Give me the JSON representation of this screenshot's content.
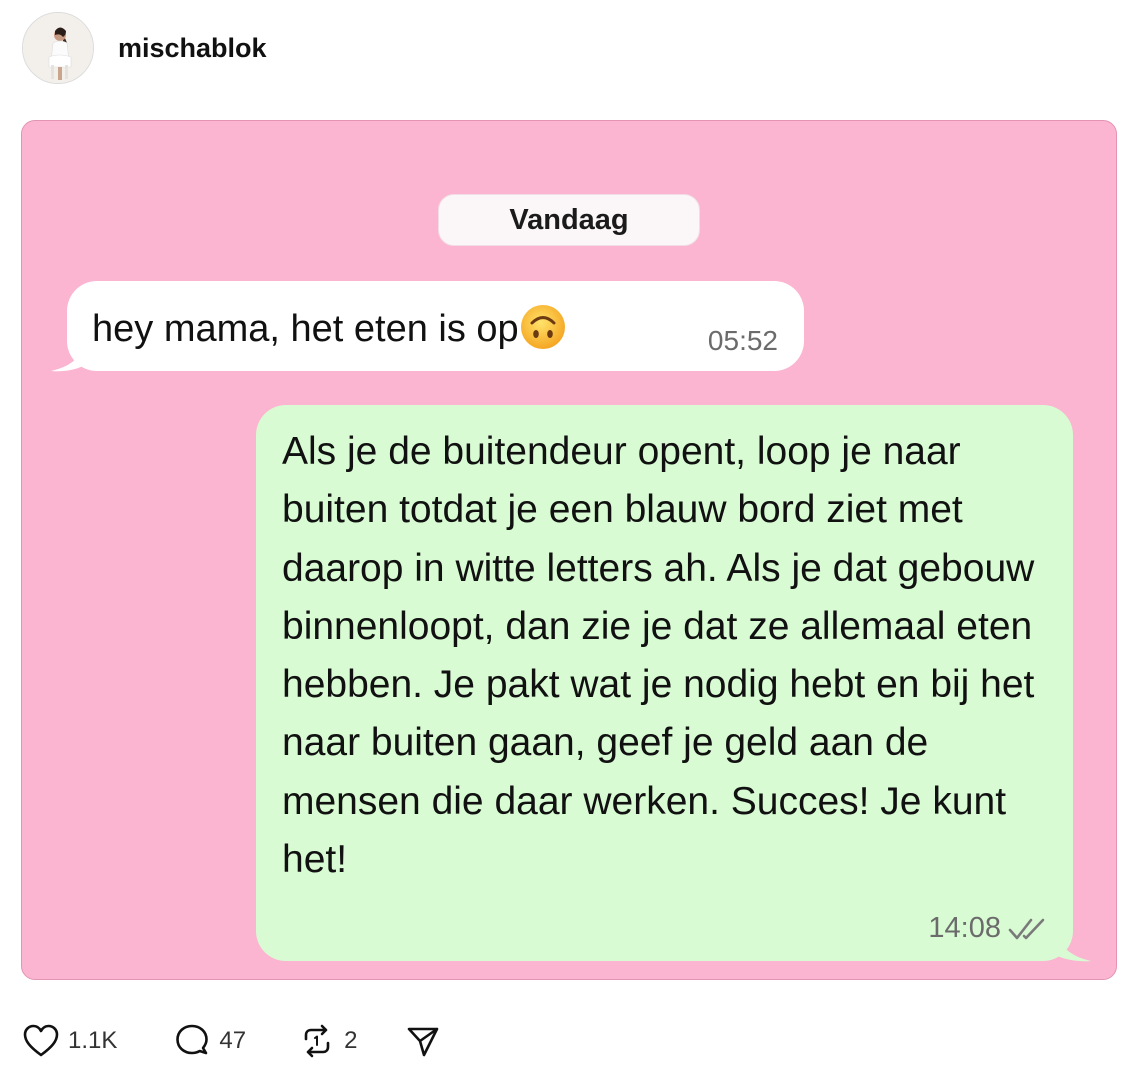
{
  "post": {
    "username": "mischablok"
  },
  "chat": {
    "date_label": "Vandaag",
    "incoming": {
      "text": "hey mama, het eten is op",
      "emoji": "upside-down-face",
      "time": "05:52"
    },
    "outgoing": {
      "text": "Als je de buitendeur opent, loop je naar buiten totdat je een blauw bord ziet met daarop in witte letters ah. Als je dat gebouw binnenloopt, dan zie je dat ze allemaal eten hebben. Je pakt wat je nodig hebt en bij het naar buiten gaan, geef je geld aan de mensen die daar werken. Succes! Je kunt het!",
      "time": "14:08",
      "status_icon": "double-check-icon"
    },
    "colors": {
      "background": "#fbb5d1",
      "incoming_bubble": "#ffffff",
      "outgoing_bubble": "#d8fbd3"
    }
  },
  "actions": {
    "likes": "1.1K",
    "comments": "47",
    "reposts": "2"
  }
}
